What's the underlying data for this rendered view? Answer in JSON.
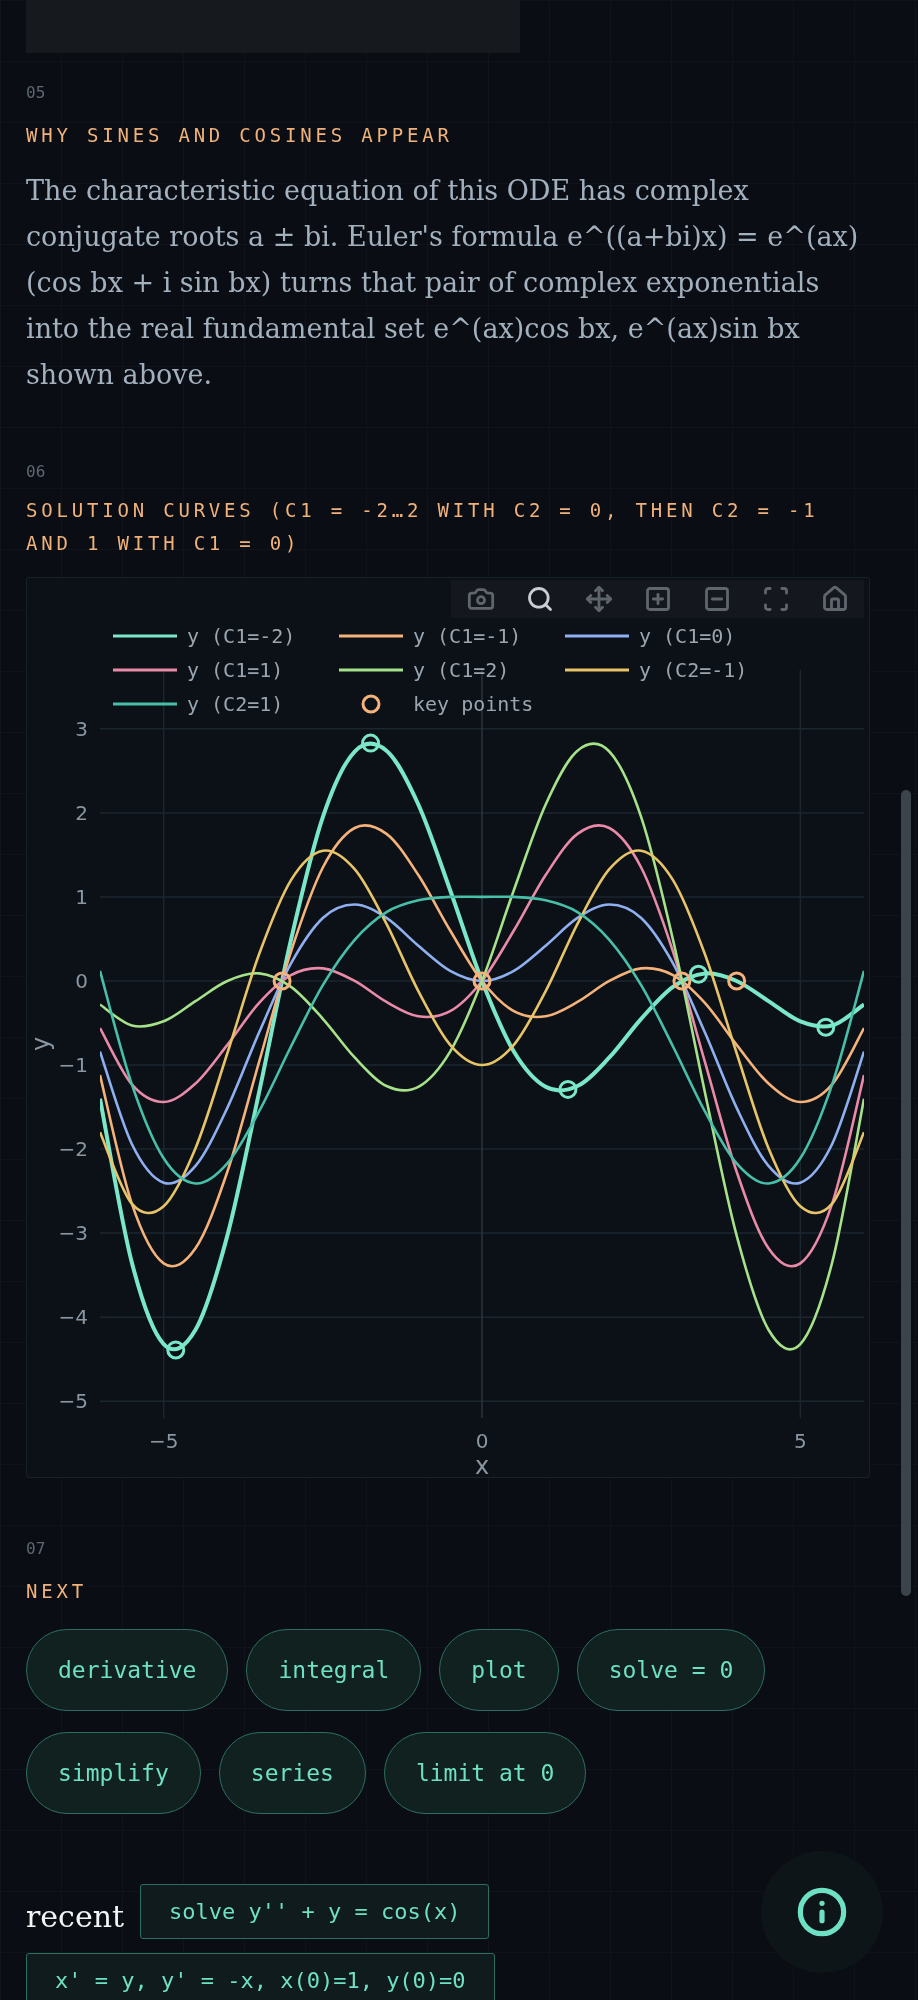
{
  "sections": [
    {
      "number": "05",
      "heading": "WHY SINES AND COSINES APPEAR",
      "paragraph": "The characteristic equation of this ODE has complex conjugate roots a ± bi. Euler's formula e^((a+bi)x) = e^(ax) (cos bx + i sin bx) turns that pair of complex exponentials into the real fundamental set e^(ax)cos bx, e^(ax)sin bx shown above."
    },
    {
      "number": "06",
      "heading": "SOLUTION CURVES (C1 = -2…2 WITH C2 = 0, THEN C2 = -1 AND 1 WITH C1 = 0)",
      "chart": {
        "modebar": [
          {
            "kind": "download",
            "selected": false
          },
          {
            "kind": "zoom",
            "selected": true
          },
          {
            "kind": "pan",
            "selected": false
          },
          {
            "kind": "zoom_in",
            "selected": false
          },
          {
            "kind": "zoom_out",
            "selected": false
          },
          {
            "kind": "autoscale",
            "selected": false
          },
          {
            "kind": "reset",
            "selected": false
          }
        ],
        "chart_data": {
          "type": "line",
          "xlabel": "x",
          "ylabel": "y",
          "xlim": [
            -6,
            6
          ],
          "ylim": [
            -5.2,
            3.7
          ],
          "grid": true,
          "legend": true,
          "xticks": [
            {
              "value": -5,
              "label": "−5"
            },
            {
              "value": 0,
              "label": "0"
            },
            {
              "value": 5,
              "label": "5"
            }
          ],
          "yticks": [
            {
              "value": -5,
              "label": "−5"
            },
            {
              "value": -4,
              "label": "−4"
            },
            {
              "value": -3,
              "label": "−3"
            },
            {
              "value": -2,
              "label": "−2"
            },
            {
              "value": -1,
              "label": "−1"
            },
            {
              "value": 0,
              "label": "0"
            },
            {
              "value": 1,
              "label": "1"
            },
            {
              "value": 2,
              "label": "2"
            },
            {
              "value": 3,
              "label": "3"
            }
          ],
          "x": [
            -6,
            -5.5,
            -5,
            -4.5,
            -4,
            -3.5,
            -3,
            -2.5,
            -2,
            -1.5,
            -1,
            -0.5,
            0,
            0.5,
            1,
            1.5,
            2,
            2.5,
            3,
            3.5,
            4,
            4.5,
            5,
            5.5,
            6
          ],
          "series": [
            {
              "name": "y (C1=-2)",
              "color": "#7ae8c8",
              "values": [
                -1.4,
                -3.35,
                -4.32,
                -4.15,
                -3.03,
                -1.32,
                0.49,
                1.95,
                2.73,
                2.74,
                2.1,
                1.08,
                0,
                -0.84,
                -1.26,
                -1.25,
                -0.91,
                -0.45,
                -0.07,
                0.09,
                0,
                -0.24,
                -0.48,
                -0.53,
                -0.28
              ]
            },
            {
              "name": "y (C1=-1)",
              "color": "#f5b27a",
              "values": [
                -1.12,
                -2.65,
                -3.36,
                -3.18,
                -2.27,
                -0.96,
                0.35,
                1.35,
                1.82,
                1.75,
                1.26,
                0.6,
                0,
                -0.36,
                -0.42,
                -0.25,
                0,
                0.15,
                0.07,
                -0.26,
                -0.76,
                -1.22,
                -1.44,
                -1.23,
                -0.56
              ]
            },
            {
              "name": "y (C1=0)",
              "color": "#8fb0f0",
              "values": [
                -0.84,
                -1.94,
                -2.4,
                -2.2,
                -1.51,
                -0.61,
                0.21,
                0.75,
                0.91,
                0.75,
                0.42,
                0.12,
                0,
                0.12,
                0.42,
                0.75,
                0.91,
                0.75,
                0.21,
                -0.61,
                -1.51,
                -2.2,
                -2.4,
                -1.94,
                -0.84
              ]
            },
            {
              "name": "y (C1=1)",
              "color": "#e98aa8",
              "values": [
                -0.56,
                -1.23,
                -1.44,
                -1.22,
                -0.76,
                -0.26,
                0.07,
                0.15,
                0,
                -0.25,
                -0.42,
                -0.36,
                0,
                0.6,
                1.26,
                1.75,
                1.82,
                1.35,
                0.35,
                -0.96,
                -2.27,
                -3.18,
                -3.36,
                -2.65,
                -1.12
              ]
            },
            {
              "name": "y (C1=2)",
              "color": "#a6e28a",
              "values": [
                -0.28,
                -0.53,
                -0.48,
                -0.24,
                0,
                0.09,
                -0.07,
                -0.45,
                -0.91,
                -1.25,
                -1.26,
                -0.84,
                0,
                1.08,
                2.1,
                2.74,
                2.73,
                1.95,
                0.49,
                -1.32,
                -3.03,
                -4.15,
                -4.32,
                -3.35,
                -1.4
              ]
            },
            {
              "name": "y (C2=-1)",
              "color": "#e8c468",
              "values": [
                -1.8,
                -2.65,
                -2.68,
                -1.99,
                -0.86,
                0.32,
                1.2,
                1.55,
                1.33,
                0.68,
                -0.12,
                -0.76,
                -1,
                -0.76,
                -0.12,
                0.68,
                1.33,
                1.55,
                1.2,
                0.32,
                -0.86,
                -1.99,
                -2.68,
                -2.65,
                -1.8
              ]
            },
            {
              "name": "y (C2=1)",
              "color": "#48bfa8",
              "values": [
                0.12,
                -1.23,
                -2.11,
                -2.41,
                -2.17,
                -1.55,
                -0.78,
                -0.05,
                0.49,
                0.82,
                0.96,
                1.0,
                1,
                1.0,
                0.96,
                0.82,
                0.49,
                -0.05,
                -0.78,
                -1.55,
                -2.17,
                -2.41,
                -2.11,
                -1.23,
                0.12
              ]
            },
            {
              "name": "key points",
              "color": "#f5b27a",
              "type": "scatter",
              "marker": "circle",
              "x": [
                -3.14,
                0,
                3.14,
                4
              ],
              "values": [
                0,
                0,
                0,
                0
              ]
            },
            {
              "color": "#7ae8c8",
              "type": "scatter",
              "marker": "circle",
              "x": [
                -4.81,
                -1.75,
                1.35,
                3.4,
                5.4
              ],
              "values": [
                -4.39,
                2.83,
                -1.29,
                0.08,
                -0.55
              ]
            }
          ]
        }
      }
    },
    {
      "number": "07",
      "heading": "NEXT",
      "chips": [
        "derivative",
        "integral",
        "plot",
        "solve = 0",
        "simplify",
        "series",
        "limit at 0"
      ]
    }
  ],
  "recent": {
    "label": "recent",
    "items": [
      "solve y'' + y = cos(x)",
      "x' = y, y' = -x, x(0)=1, y(0)=0"
    ]
  }
}
